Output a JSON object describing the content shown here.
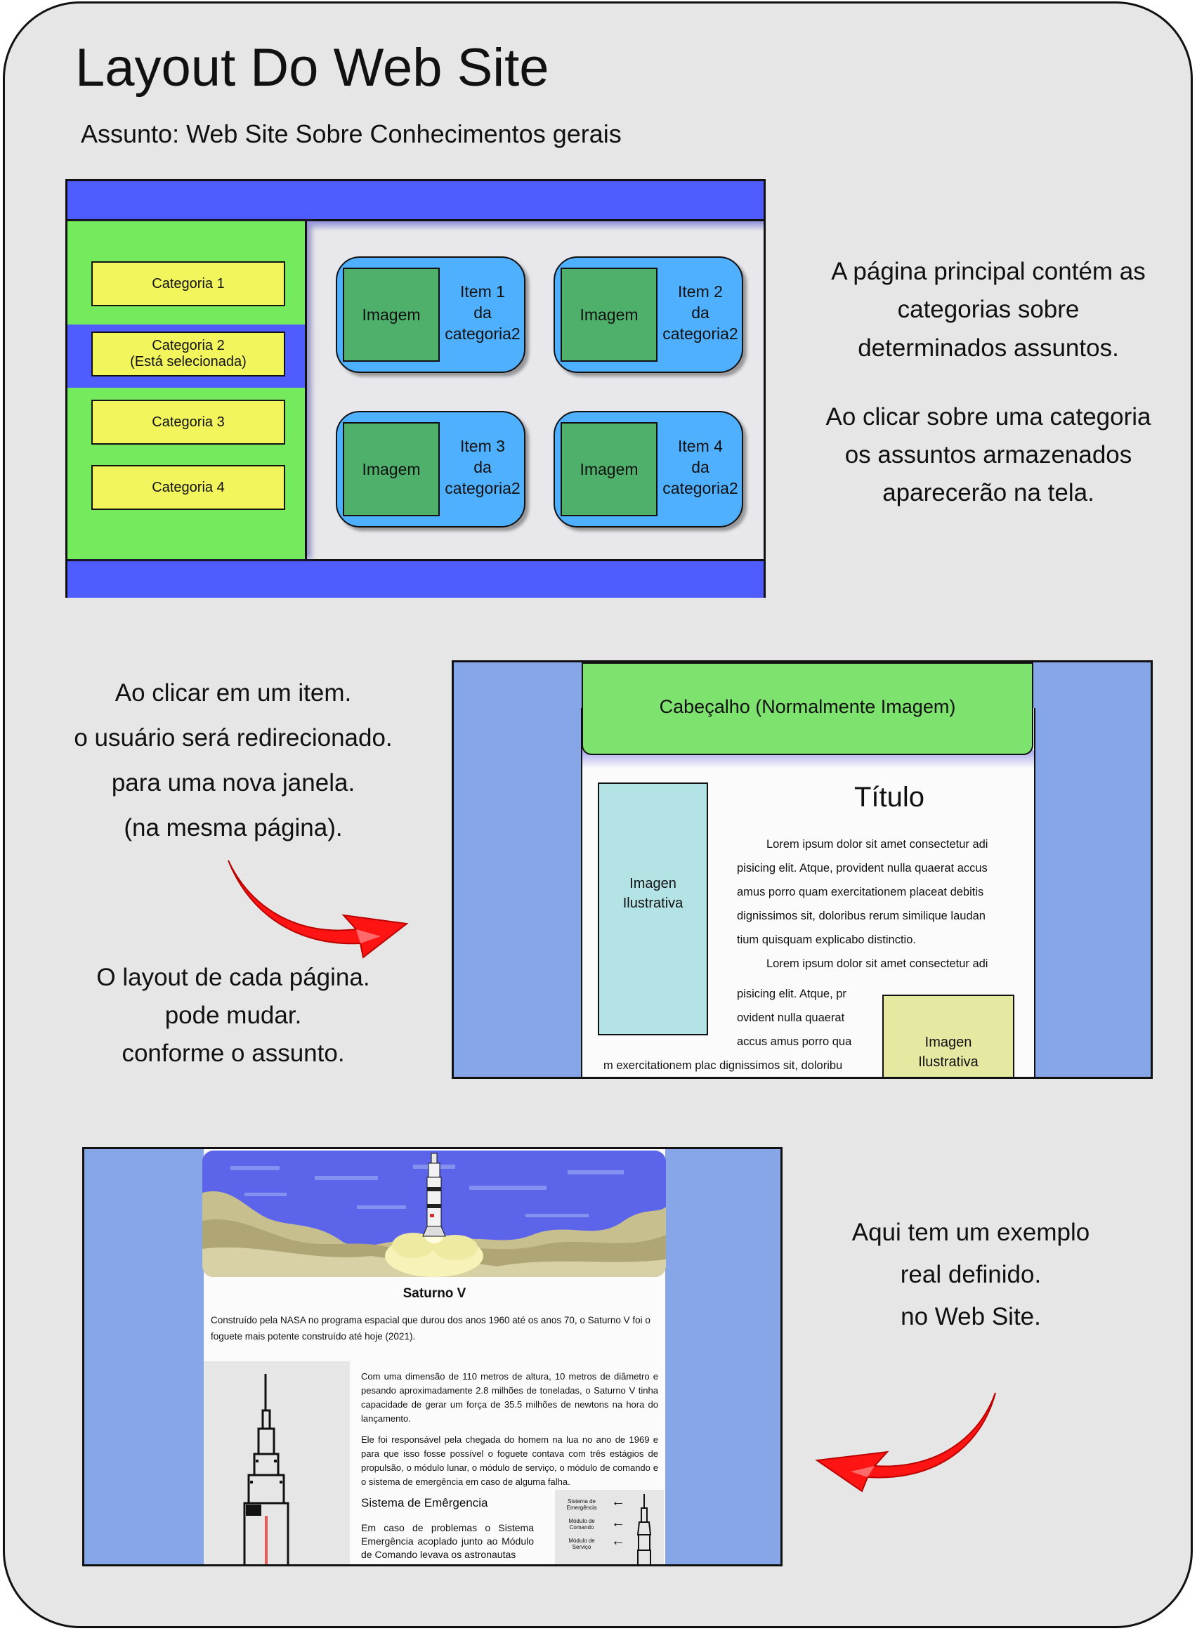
{
  "page": {
    "title": "Layout Do Web Site",
    "subtitle": "Assunto: Web Site Sobre Conhecimentos gerais"
  },
  "wireframe1": {
    "categories": [
      "Categoria 1",
      "Categoria 2",
      "(Está selecionada)",
      "Categoria 3",
      "Categoria 4"
    ],
    "image_label": "Imagem",
    "items": [
      {
        "l1": "Item 1",
        "l2": "da",
        "l3": "categoria2"
      },
      {
        "l1": "Item 2",
        "l2": "da",
        "l3": "categoria2"
      },
      {
        "l1": "Item 3",
        "l2": "da",
        "l3": "categoria2"
      },
      {
        "l1": "Item 4",
        "l2": "da",
        "l3": "categoria2"
      }
    ],
    "colors": {
      "header": "#4f5dff",
      "sidebar": "#74ea5c",
      "selected": "#4f5dff",
      "category": "#f3f55d",
      "item": "#4fb0ff",
      "image": "#4fb06c"
    }
  },
  "desc1": {
    "lines": [
      "A página principal contém as",
      "categorias sobre",
      "determinados assuntos."
    ],
    "lines2": [
      "Ao clicar sobre uma categoria",
      "os assuntos armazenados",
      "aparecerão na tela."
    ]
  },
  "desc2": {
    "lines": [
      "Ao clicar em um item.",
      "o usuário será redirecionado.",
      "para uma nova janela.",
      "(na mesma página)."
    ],
    "lines2": [
      "O layout de cada página.",
      "pode mudar.",
      "conforme o assunto."
    ]
  },
  "wireframe2": {
    "header": "Cabeçalho (Normalmente Imagem)",
    "title": "Título",
    "image_left": [
      "Imagen",
      "Ilustrativa"
    ],
    "image_right": [
      "Imagen",
      "Ilustrativa"
    ],
    "lorem": [
      "Lorem ipsum dolor sit amet consectetur adi",
      "pisicing elit. Atque, provident nulla quaerat accus",
      "amus porro quam exercitationem placeat debitis",
      "dignissimos sit, doloribus rerum similique laudan",
      "tium quisquam explicabo distinctio.",
      "Lorem ipsum dolor sit amet consectetur adi",
      "pisicing elit. Atque, pr",
      "ovident nulla quaerat",
      "accus amus porro qua",
      "m exercitationem plac dignissimos sit, doloribu"
    ]
  },
  "desc3": {
    "lines": [
      "Aqui tem um exemplo",
      "real definido.",
      "no Web Site."
    ]
  },
  "example": {
    "title": "Saturno V",
    "intro": "Construído pela NASA no programa espacial que durou dos anos 1960 até os anos 70, o Saturno V foi o foguete mais potente construído até hoje (2021).",
    "p1": "Com uma dimensão de 110 metros de altura, 10 metros de diâmetro e pesando aproximadamente 2.8 milhões de toneladas, o Saturno V tinha capacidade de gerar um força de 35.5 milhões de newtons na hora do lançamento.",
    "p2": "Ele foi responsável pela chegada do homem na lua no ano de 1969 e para que isso fosse possível o foguete contava com três estágios de propulsão, o módulo lunar, o módulo de serviço, o módulo de comando e o sistema de emergência em caso de alguma falha.",
    "h2": "Sistema de Emêrgencia",
    "p3": "Em caso de problemas o Sistema Emergência acoplado junto ao Módulo de Comando levava os astronautas",
    "diagram_labels": [
      "Sistema de Emergência",
      "Módulo de Comando",
      "Módulo de Serviço"
    ],
    "arrow_glyph": "←"
  }
}
